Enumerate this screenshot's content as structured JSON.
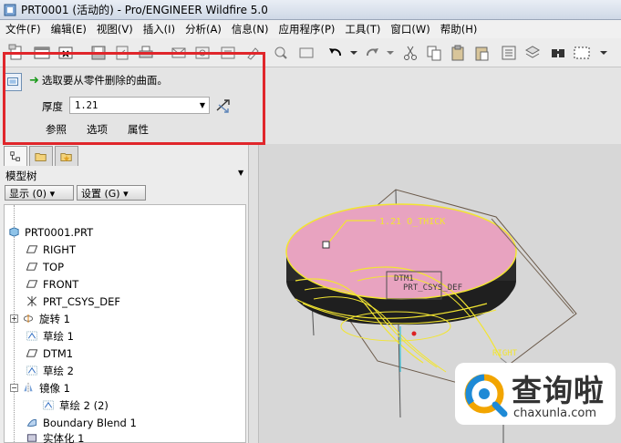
{
  "window": {
    "title": "PRT0001 (活动的) - Pro/ENGINEER Wildfire 5.0"
  },
  "menubar": {
    "items": [
      "文件(F)",
      "编辑(E)",
      "视图(V)",
      "插入(I)",
      "分析(A)",
      "信息(N)",
      "应用程序(P)",
      "工具(T)",
      "窗口(W)",
      "帮助(H)"
    ]
  },
  "dashboard": {
    "prompt": "选取要从零件删除的曲面。",
    "thickness_label": "厚度",
    "thickness_value": "1.21",
    "tabs": [
      "参照",
      "选项",
      "属性"
    ]
  },
  "left_pane": {
    "title": "模型树",
    "show_button": "显示 (0) ▾",
    "settings_button": "设置 (G) ▾",
    "tree": [
      {
        "label": "PRT0001.PRT",
        "icon": "part-icon",
        "level": 0
      },
      {
        "label": "RIGHT",
        "icon": "datum-plane-icon",
        "level": 1
      },
      {
        "label": "TOP",
        "icon": "datum-plane-icon",
        "level": 1
      },
      {
        "label": "FRONT",
        "icon": "datum-plane-icon",
        "level": 1
      },
      {
        "label": "PRT_CSYS_DEF",
        "icon": "csys-icon",
        "level": 1
      },
      {
        "label": "旋转 1",
        "icon": "revolve-icon",
        "level": 1,
        "expandable": true
      },
      {
        "label": "草绘 1",
        "icon": "sketch-icon",
        "level": 1
      },
      {
        "label": "DTM1",
        "icon": "datum-plane-icon",
        "level": 1
      },
      {
        "label": "草绘 2",
        "icon": "sketch-icon",
        "level": 1
      },
      {
        "label": "镜像 1",
        "icon": "mirror-icon",
        "level": 1,
        "expandable": true,
        "expanded": true
      },
      {
        "label": "草绘 2 (2)",
        "icon": "sketch-icon",
        "level": 2
      },
      {
        "label": "Boundary Blend 1",
        "icon": "boundary-blend-icon",
        "level": 1
      },
      {
        "label": "实体化 1",
        "icon": "solidify-icon",
        "level": 1
      }
    ]
  },
  "graphics": {
    "dimension_label": "1.21 O_THICK",
    "datum_labels": [
      "DTM1",
      "PRT_CSYS_DEF",
      "RIGHT"
    ]
  },
  "watermark": {
    "name": "查询啦",
    "url": "chaxunla.com"
  },
  "colors": {
    "highlight_box": "#e0262b",
    "surface_fill": "#e8a3c0",
    "surface_edge": "#f2e531",
    "prompt_arrow": "#1b9a1b"
  }
}
